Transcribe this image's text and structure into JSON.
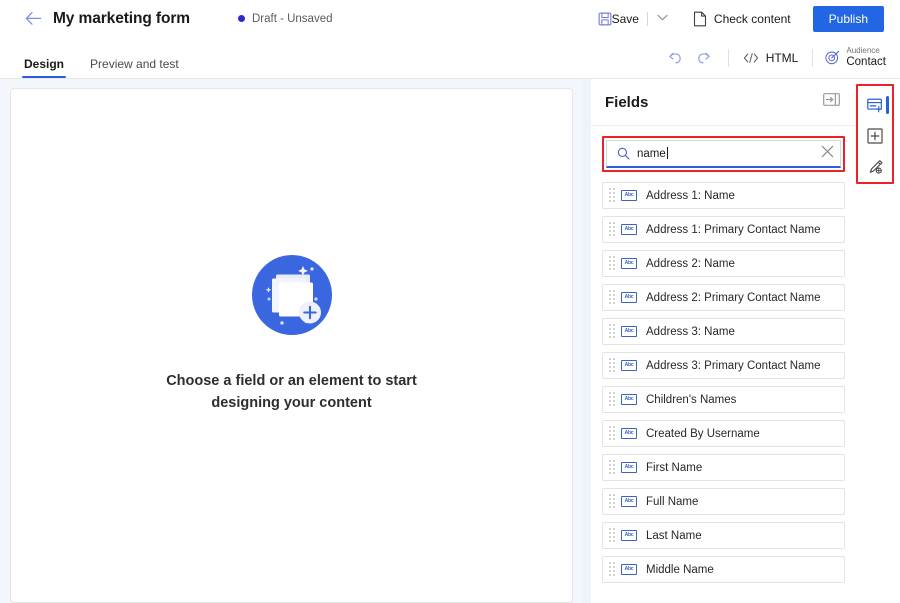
{
  "header": {
    "back_icon": "arrow-left-icon",
    "title": "My marketing form",
    "status": "Draft - Unsaved",
    "status_dot_color": "#2b2bc7",
    "save_label": "Save",
    "save_icon": "save-floppy-icon",
    "save_dropdown_icon": "chevron-down-icon",
    "check_content_label": "Check content",
    "check_content_icon": "page-check-icon",
    "publish_label": "Publish",
    "publish_color": "#2266e3"
  },
  "commandbar": {
    "tabs": [
      {
        "label": "Design",
        "active": true
      },
      {
        "label": "Preview and test",
        "active": false
      }
    ],
    "undo_icon": "undo-icon",
    "redo_icon": "redo-icon",
    "html_label": "HTML",
    "html_icon": "code-brackets-icon",
    "audience_sup": "Audience",
    "audience_main": "Contact",
    "audience_icon": "target-icon"
  },
  "canvas": {
    "illustration_icon": "stacked-cards-plus-illustration",
    "illustration_color": "#3a66e0",
    "empty_text_line1": "Choose a field or an element to start",
    "empty_text_line2": "designing your content",
    "background_color": "#f3f6fc"
  },
  "fields_panel": {
    "title": "Fields",
    "collapse_icon": "panel-collapse-icon",
    "search": {
      "icon": "search-icon",
      "value": "name",
      "placeholder": "Search",
      "clear_icon": "close-x-icon",
      "highlight_color": "#e8242a",
      "focus_underline_color": "#2b5fd9"
    },
    "items": [
      {
        "icon": "abc-text-field-icon",
        "label": "Address 1: Name"
      },
      {
        "icon": "abc-text-field-icon",
        "label": "Address 1: Primary Contact Name"
      },
      {
        "icon": "abc-text-field-icon",
        "label": "Address 2: Name"
      },
      {
        "icon": "abc-text-field-icon",
        "label": "Address 2: Primary Contact Name"
      },
      {
        "icon": "abc-text-field-icon",
        "label": "Address 3: Name"
      },
      {
        "icon": "abc-text-field-icon",
        "label": "Address 3: Primary Contact Name"
      },
      {
        "icon": "abc-text-field-icon",
        "label": "Children's Names"
      },
      {
        "icon": "abc-text-field-icon",
        "label": "Created By Username"
      },
      {
        "icon": "abc-text-field-icon",
        "label": "First Name"
      },
      {
        "icon": "abc-text-field-icon",
        "label": "Full Name"
      },
      {
        "icon": "abc-text-field-icon",
        "label": "Last Name"
      },
      {
        "icon": "abc-text-field-icon",
        "label": "Middle Name"
      }
    ]
  },
  "rail": {
    "highlight_color": "#e8242a",
    "selected_indicator_color": "#2b5fd9",
    "buttons": [
      {
        "icon": "fields-panel-icon",
        "selected": true
      },
      {
        "icon": "add-element-icon",
        "selected": false
      },
      {
        "icon": "styles-brush-icon",
        "selected": false
      }
    ]
  }
}
